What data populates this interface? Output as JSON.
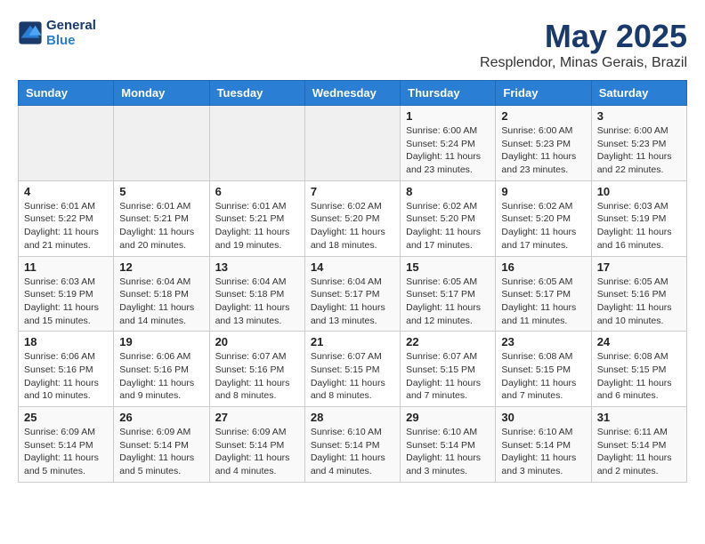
{
  "logo": {
    "line1": "General",
    "line2": "Blue"
  },
  "title": "May 2025",
  "location": "Resplendor, Minas Gerais, Brazil",
  "days_of_week": [
    "Sunday",
    "Monday",
    "Tuesday",
    "Wednesday",
    "Thursday",
    "Friday",
    "Saturday"
  ],
  "weeks": [
    [
      {
        "day": "",
        "info": ""
      },
      {
        "day": "",
        "info": ""
      },
      {
        "day": "",
        "info": ""
      },
      {
        "day": "",
        "info": ""
      },
      {
        "day": "1",
        "info": "Sunrise: 6:00 AM\nSunset: 5:24 PM\nDaylight: 11 hours\nand 23 minutes."
      },
      {
        "day": "2",
        "info": "Sunrise: 6:00 AM\nSunset: 5:23 PM\nDaylight: 11 hours\nand 23 minutes."
      },
      {
        "day": "3",
        "info": "Sunrise: 6:00 AM\nSunset: 5:23 PM\nDaylight: 11 hours\nand 22 minutes."
      }
    ],
    [
      {
        "day": "4",
        "info": "Sunrise: 6:01 AM\nSunset: 5:22 PM\nDaylight: 11 hours\nand 21 minutes."
      },
      {
        "day": "5",
        "info": "Sunrise: 6:01 AM\nSunset: 5:21 PM\nDaylight: 11 hours\nand 20 minutes."
      },
      {
        "day": "6",
        "info": "Sunrise: 6:01 AM\nSunset: 5:21 PM\nDaylight: 11 hours\nand 19 minutes."
      },
      {
        "day": "7",
        "info": "Sunrise: 6:02 AM\nSunset: 5:20 PM\nDaylight: 11 hours\nand 18 minutes."
      },
      {
        "day": "8",
        "info": "Sunrise: 6:02 AM\nSunset: 5:20 PM\nDaylight: 11 hours\nand 17 minutes."
      },
      {
        "day": "9",
        "info": "Sunrise: 6:02 AM\nSunset: 5:20 PM\nDaylight: 11 hours\nand 17 minutes."
      },
      {
        "day": "10",
        "info": "Sunrise: 6:03 AM\nSunset: 5:19 PM\nDaylight: 11 hours\nand 16 minutes."
      }
    ],
    [
      {
        "day": "11",
        "info": "Sunrise: 6:03 AM\nSunset: 5:19 PM\nDaylight: 11 hours\nand 15 minutes."
      },
      {
        "day": "12",
        "info": "Sunrise: 6:04 AM\nSunset: 5:18 PM\nDaylight: 11 hours\nand 14 minutes."
      },
      {
        "day": "13",
        "info": "Sunrise: 6:04 AM\nSunset: 5:18 PM\nDaylight: 11 hours\nand 13 minutes."
      },
      {
        "day": "14",
        "info": "Sunrise: 6:04 AM\nSunset: 5:17 PM\nDaylight: 11 hours\nand 13 minutes."
      },
      {
        "day": "15",
        "info": "Sunrise: 6:05 AM\nSunset: 5:17 PM\nDaylight: 11 hours\nand 12 minutes."
      },
      {
        "day": "16",
        "info": "Sunrise: 6:05 AM\nSunset: 5:17 PM\nDaylight: 11 hours\nand 11 minutes."
      },
      {
        "day": "17",
        "info": "Sunrise: 6:05 AM\nSunset: 5:16 PM\nDaylight: 11 hours\nand 10 minutes."
      }
    ],
    [
      {
        "day": "18",
        "info": "Sunrise: 6:06 AM\nSunset: 5:16 PM\nDaylight: 11 hours\nand 10 minutes."
      },
      {
        "day": "19",
        "info": "Sunrise: 6:06 AM\nSunset: 5:16 PM\nDaylight: 11 hours\nand 9 minutes."
      },
      {
        "day": "20",
        "info": "Sunrise: 6:07 AM\nSunset: 5:16 PM\nDaylight: 11 hours\nand 8 minutes."
      },
      {
        "day": "21",
        "info": "Sunrise: 6:07 AM\nSunset: 5:15 PM\nDaylight: 11 hours\nand 8 minutes."
      },
      {
        "day": "22",
        "info": "Sunrise: 6:07 AM\nSunset: 5:15 PM\nDaylight: 11 hours\nand 7 minutes."
      },
      {
        "day": "23",
        "info": "Sunrise: 6:08 AM\nSunset: 5:15 PM\nDaylight: 11 hours\nand 7 minutes."
      },
      {
        "day": "24",
        "info": "Sunrise: 6:08 AM\nSunset: 5:15 PM\nDaylight: 11 hours\nand 6 minutes."
      }
    ],
    [
      {
        "day": "25",
        "info": "Sunrise: 6:09 AM\nSunset: 5:14 PM\nDaylight: 11 hours\nand 5 minutes."
      },
      {
        "day": "26",
        "info": "Sunrise: 6:09 AM\nSunset: 5:14 PM\nDaylight: 11 hours\nand 5 minutes."
      },
      {
        "day": "27",
        "info": "Sunrise: 6:09 AM\nSunset: 5:14 PM\nDaylight: 11 hours\nand 4 minutes."
      },
      {
        "day": "28",
        "info": "Sunrise: 6:10 AM\nSunset: 5:14 PM\nDaylight: 11 hours\nand 4 minutes."
      },
      {
        "day": "29",
        "info": "Sunrise: 6:10 AM\nSunset: 5:14 PM\nDaylight: 11 hours\nand 3 minutes."
      },
      {
        "day": "30",
        "info": "Sunrise: 6:10 AM\nSunset: 5:14 PM\nDaylight: 11 hours\nand 3 minutes."
      },
      {
        "day": "31",
        "info": "Sunrise: 6:11 AM\nSunset: 5:14 PM\nDaylight: 11 hours\nand 2 minutes."
      }
    ]
  ]
}
